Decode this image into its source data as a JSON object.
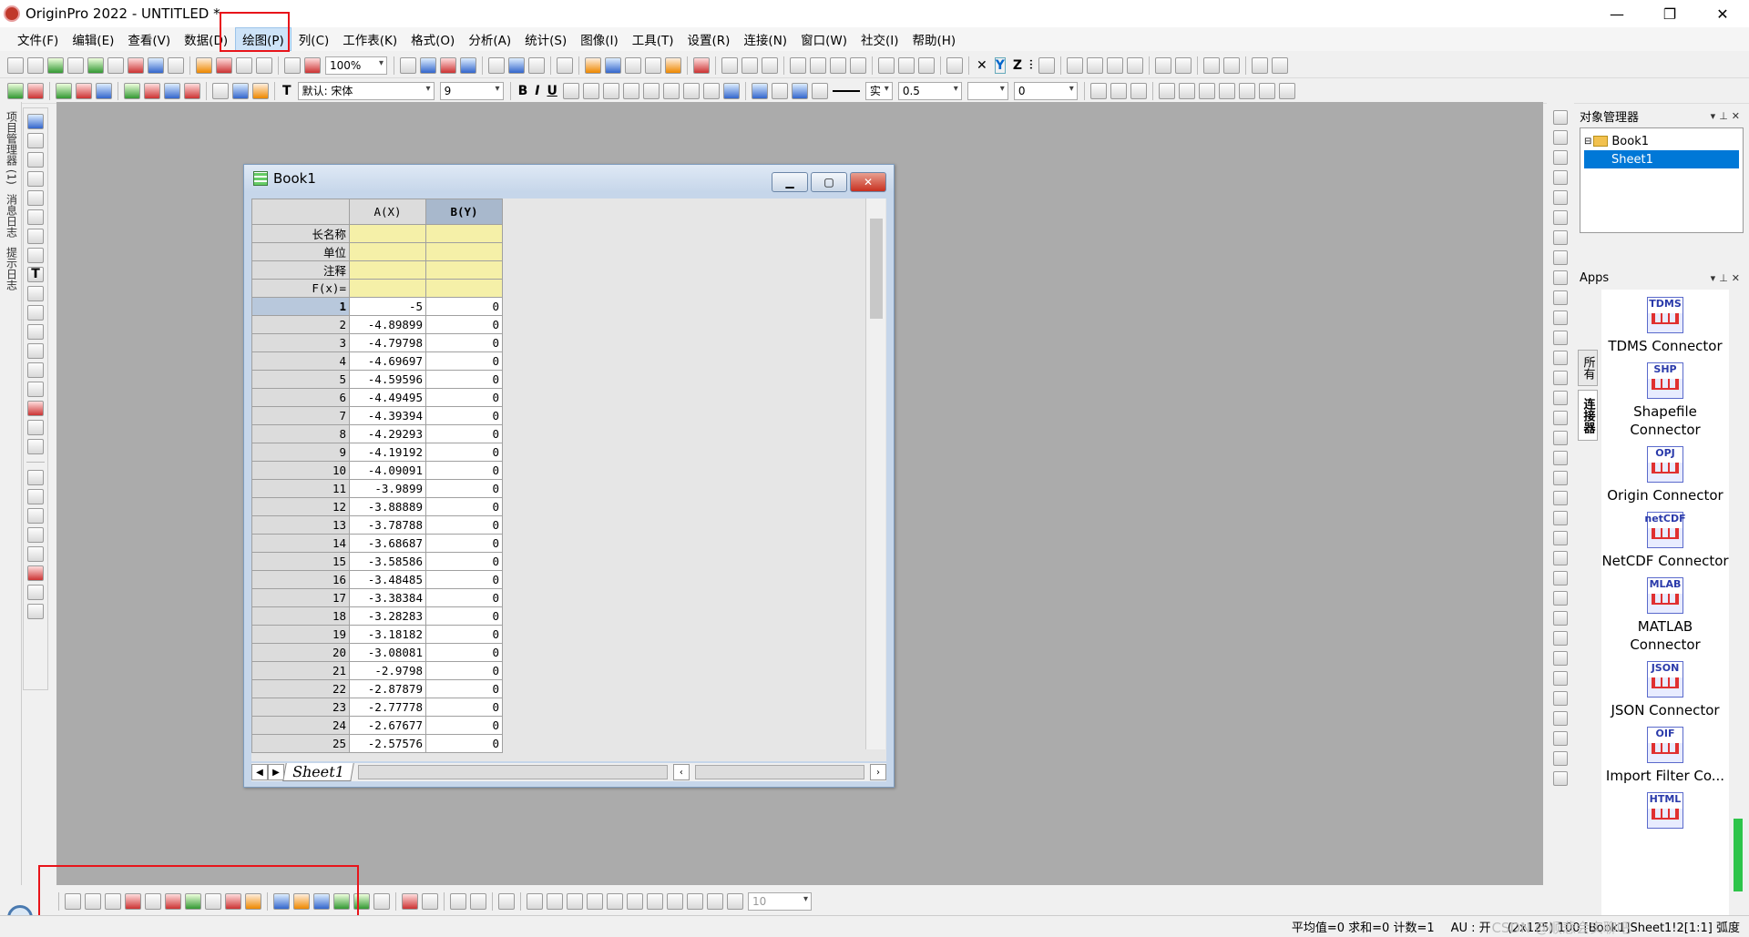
{
  "window": {
    "title": "OriginPro 2022 - UNTITLED *",
    "min": "—",
    "max": "❐",
    "close": "✕"
  },
  "menu": [
    "文件(F)",
    "编辑(E)",
    "查看(V)",
    "数据(D)",
    "绘图(P)",
    "列(C)",
    "工作表(K)",
    "格式(O)",
    "分析(A)",
    "统计(S)",
    "图像(I)",
    "工具(T)",
    "设置(R)",
    "连接(N)",
    "窗口(W)",
    "社交(I)",
    "帮助(H)"
  ],
  "active_menu": "绘图(P)",
  "toolbar1": {
    "zoom": "100%"
  },
  "toolbar2": {
    "font": "默认: 宋体",
    "size": "9",
    "b": "B",
    "i": "I",
    "u": "U",
    "linewidth": "0.5",
    "linestyle": "实",
    "border": "0"
  },
  "left_tabs": [
    "项目管理器 (1)",
    "消息日志",
    "提示日志"
  ],
  "object_manager": {
    "title": "对象管理器",
    "book": "Book1",
    "sheet": "Sheet1"
  },
  "apps": {
    "title": "Apps",
    "side_tabs": [
      "所有",
      "连接器"
    ],
    "items": [
      {
        "tile": "TDMS",
        "name": "TDMS Connector"
      },
      {
        "tile": "SHP",
        "name": "Shapefile Connector"
      },
      {
        "tile": "OPJ",
        "name": "Origin Connector"
      },
      {
        "tile": "netCDF",
        "name": "NetCDF Connector"
      },
      {
        "tile": "MLAB",
        "name": "MATLAB Connector"
      },
      {
        "tile": "JSON",
        "name": "JSON Connector"
      },
      {
        "tile": "OIF",
        "name": "Import Filter Co..."
      },
      {
        "tile": "HTML",
        "name": ""
      }
    ]
  },
  "book": {
    "title": "Book1",
    "sheet_tab": "Sheet1",
    "columns": [
      "A(X)",
      "B(Y)"
    ],
    "label_rows": [
      "长名称",
      "单位",
      "注释",
      "F(x)="
    ],
    "rows": [
      [
        "1",
        "-5",
        "0"
      ],
      [
        "2",
        "-4.89899",
        "0"
      ],
      [
        "3",
        "-4.79798",
        "0"
      ],
      [
        "4",
        "-4.69697",
        "0"
      ],
      [
        "5",
        "-4.59596",
        "0"
      ],
      [
        "6",
        "-4.49495",
        "0"
      ],
      [
        "7",
        "-4.39394",
        "0"
      ],
      [
        "8",
        "-4.29293",
        "0"
      ],
      [
        "9",
        "-4.19192",
        "0"
      ],
      [
        "10",
        "-4.09091",
        "0"
      ],
      [
        "11",
        "-3.9899",
        "0"
      ],
      [
        "12",
        "-3.88889",
        "0"
      ],
      [
        "13",
        "-3.78788",
        "0"
      ],
      [
        "14",
        "-3.68687",
        "0"
      ],
      [
        "15",
        "-3.58586",
        "0"
      ],
      [
        "16",
        "-3.48485",
        "0"
      ],
      [
        "17",
        "-3.38384",
        "0"
      ],
      [
        "18",
        "-3.28283",
        "0"
      ],
      [
        "19",
        "-3.18182",
        "0"
      ],
      [
        "20",
        "-3.08081",
        "0"
      ],
      [
        "21",
        "-2.9798",
        "0"
      ],
      [
        "22",
        "-2.87879",
        "0"
      ],
      [
        "23",
        "-2.77778",
        "0"
      ],
      [
        "24",
        "-2.67677",
        "0"
      ],
      [
        "25",
        "-2.57576",
        "0"
      ]
    ]
  },
  "bottom_toolbar": {
    "size": "10"
  },
  "status": {
    "stats": "平均值=0 求和=0 计数=1",
    "au": "AU : 开",
    "info": "(2x125) 100 [Book1]Sheet1!2[1:1] 弧度"
  },
  "watermark": "CSDN @顺悲会实聊吧"
}
